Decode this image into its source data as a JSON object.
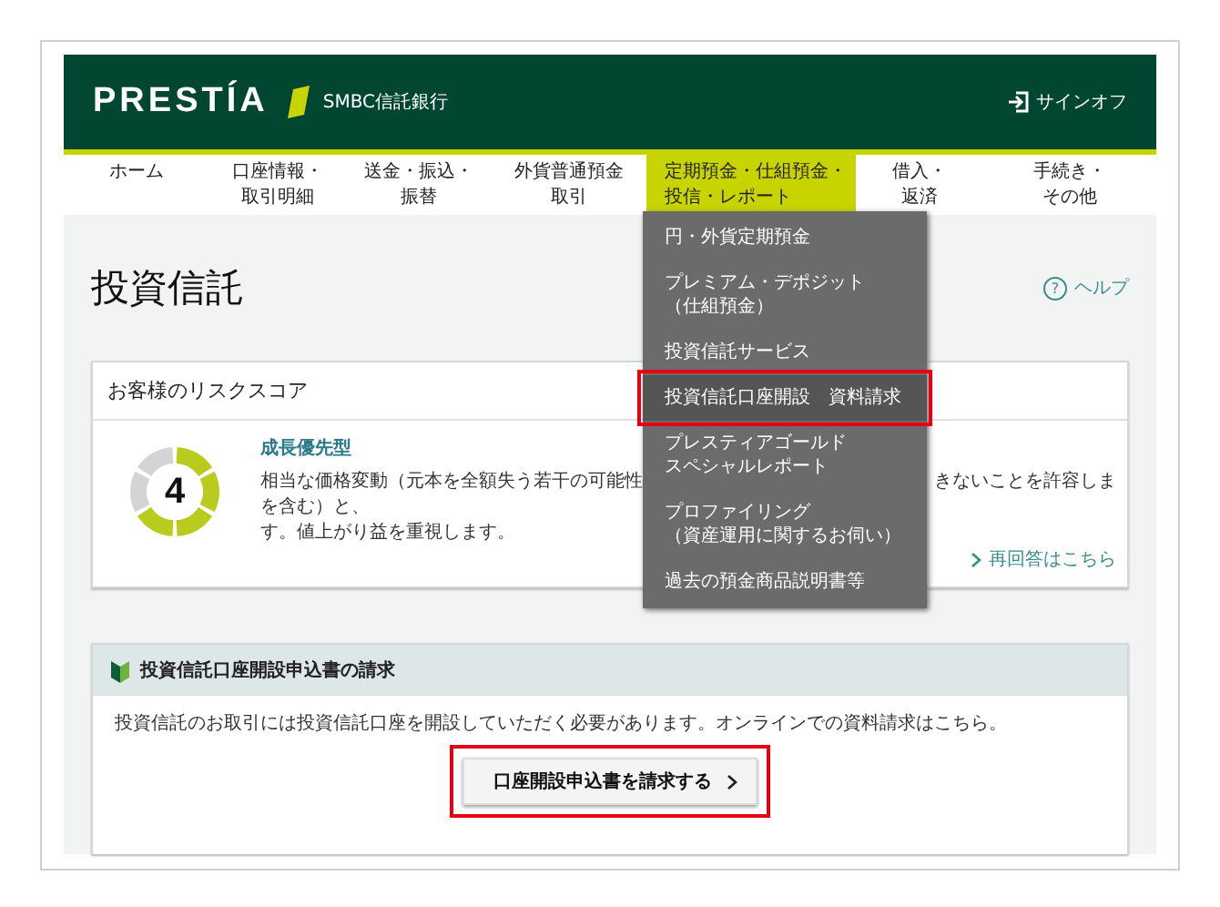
{
  "header": {
    "logo": "PRESTÍA",
    "bank_name": "SMBC信託銀行",
    "signoff": "サインオフ"
  },
  "nav": [
    {
      "lines": [
        "ホーム"
      ],
      "selected": false
    },
    {
      "lines": [
        "口座情報・",
        "取引明細"
      ],
      "selected": false
    },
    {
      "lines": [
        "送金・振込・",
        "振替"
      ],
      "selected": false
    },
    {
      "lines": [
        "外貨普通預金",
        "取引"
      ],
      "selected": false
    },
    {
      "lines": [
        "定期預金・仕組預金・",
        "投信・レポート"
      ],
      "selected": true
    },
    {
      "lines": [
        "借入・",
        "返済"
      ],
      "selected": false
    },
    {
      "lines": [
        "手続き・",
        "その他"
      ],
      "selected": false
    }
  ],
  "dropdown": {
    "items": [
      {
        "lines": [
          "円・外貨定期預金"
        ],
        "selected": false,
        "annotated": false
      },
      {
        "lines": [
          "プレミアム・デポジット",
          "（仕組預金）"
        ],
        "selected": false,
        "annotated": false
      },
      {
        "lines": [
          "投資信託サービス"
        ],
        "selected": false,
        "annotated": false
      },
      {
        "lines": [
          "投資信託口座開設　資料請求"
        ],
        "selected": true,
        "annotated": true
      },
      {
        "lines": [
          "プレスティアゴールド",
          "スペシャルレポート"
        ],
        "selected": false,
        "annotated": false
      },
      {
        "lines": [
          "プロファイリング",
          "（資産運用に関するお伺い）"
        ],
        "selected": false,
        "annotated": false
      },
      {
        "lines": [
          "過去の預金商品説明書等"
        ],
        "selected": false,
        "annotated": false
      }
    ]
  },
  "page_title": "投資信託",
  "help": {
    "icon": "?",
    "label": "ヘルプ"
  },
  "risk_card": {
    "title": "お客様のリスクスコア",
    "score": "4",
    "level": 0.667,
    "type_name": "成長優先型",
    "desc_left": "相当な価格変動（元本を全額失う若干の可能性を含む）と、",
    "desc_right": "きないことを許容しま",
    "desc_end": "す。値上がり益を重視します。",
    "link": "再回答はこちら"
  },
  "request_card": {
    "title": "投資信託口座開設申込書の請求",
    "text": "投資信託のお取引には投資信託口座を開設していただく必要があります。オンラインでの資料請求はこちら。",
    "button": {
      "label": "口座開設申込書を請求する",
      "annotated": true
    }
  }
}
